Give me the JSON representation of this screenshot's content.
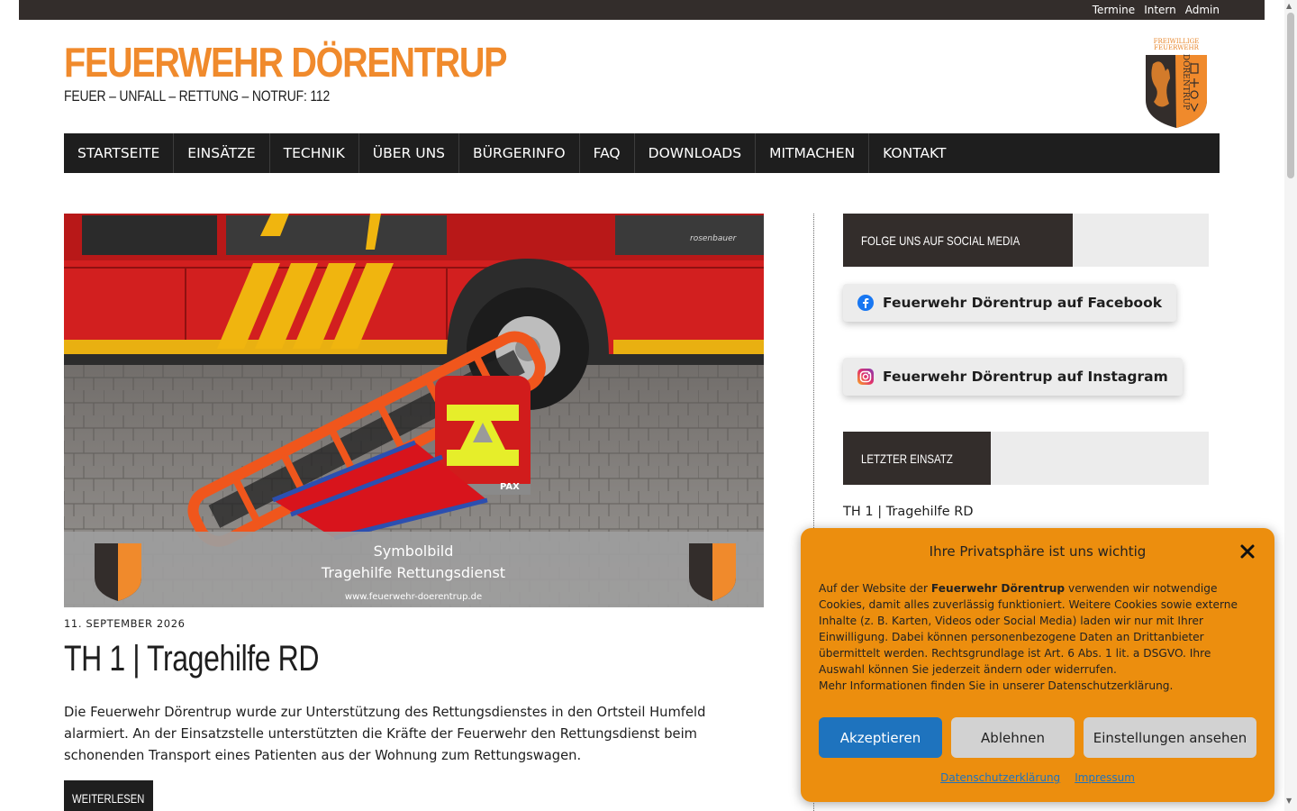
{
  "topbar": {
    "links": [
      "Termine",
      "Intern",
      "Admin"
    ]
  },
  "header": {
    "title": "FEUERWEHR DÖRENTRUP",
    "tagline": "FEUER – UNFALL – RETTUNG – NOTRUF: 112",
    "crest": {
      "top_text_1": "FREIWILLIGE",
      "top_text_2": "FEUERWEHR",
      "side_text": "DÖRENTRUP"
    }
  },
  "nav": {
    "items": [
      "STARTSEITE",
      "EINSÄTZE",
      "TECHNIK",
      "ÜBER UNS",
      "BÜRGERINFO",
      "FAQ",
      "DOWNLOADS",
      "MITMACHEN",
      "KONTAKT"
    ]
  },
  "post": {
    "image_caption_1": "Symbolbild",
    "image_caption_2": "Tragehilfe Rettungsdienst",
    "image_url_text": "www.feuerwehr-doerentrup.de",
    "truck_brand": "rosenbauer",
    "bag_brand": "PAX",
    "date": "11. SEPTEMBER 2026",
    "title": "TH 1 | Tragehilfe RD",
    "excerpt": "Die Feuerwehr Dörentrup wurde zur Unterstützung des Rettungsdienstes in den Ortsteil Humfeld alarmiert. An der Einsatzstelle unterstützten die Kräfte der Feuerwehr den Rettungsdienst beim schonenden Transport eines Patienten aus der Wohnung zum Rettungswagen.",
    "read_more": "WEITERLESEN"
  },
  "sidebar": {
    "social_heading": "FOLGE UNS AUF SOCIAL MEDIA",
    "facebook_label": "Feuerwehr Dörentrup auf Facebook",
    "instagram_label": "Feuerwehr Dörentrup auf Instagram",
    "last_heading": "LETZTER EINSATZ",
    "last_item": "TH 1 | Tragehilfe RD"
  },
  "cookie": {
    "title": "Ihre Privatsphäre ist uns wichtig",
    "body_prefix": "Auf der Website der ",
    "body_strong": "Feuerwehr Dörentrup",
    "body_suffix": " verwenden wir notwendige Cookies, damit alles zuverlässig funktioniert. Weitere Cookies sowie externe Inhalte (z. B. Karten, Videos oder Social Media) laden wir nur mit Ihrer Einwilligung. Dabei können personenbezogene Daten an Drittanbieter übermittelt werden. Rechtsgrundlage ist Art. 6 Abs. 1 lit. a DSGVO. Ihre Auswahl können Sie jederzeit ändern oder widerrufen.",
    "body_more": "Mehr Informationen finden Sie in unserer Datenschutzerklärung.",
    "accept": "Akzeptieren",
    "deny": "Ablehnen",
    "settings": "Einstellungen ansehen",
    "link_privacy": "Datenschutzerklärung",
    "link_imprint": "Impressum"
  },
  "colors": {
    "brand_orange": "#f08a2c",
    "topbar": "#332d2b",
    "nav": "#1e1e1e",
    "cookie_bg": "#ec8e0e",
    "accept_blue": "#1e73be"
  }
}
